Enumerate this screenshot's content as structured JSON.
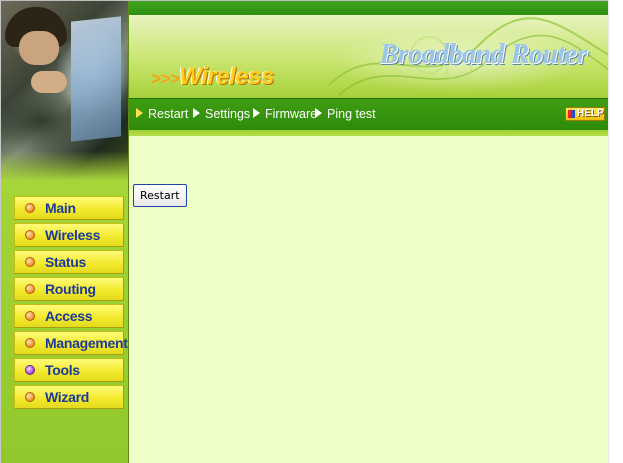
{
  "banner": {
    "section_prefix": ">>>",
    "section_title": "Wireless",
    "brand": "Broadband Router"
  },
  "topbar": {
    "items": [
      {
        "label": "Restart"
      },
      {
        "label": "Settings"
      },
      {
        "label": "Firmware"
      },
      {
        "label": "Ping test"
      }
    ],
    "help_label": "HELP"
  },
  "sidebar": {
    "items": [
      {
        "label": "Main",
        "active": false
      },
      {
        "label": "Wireless",
        "active": false
      },
      {
        "label": "Status",
        "active": false
      },
      {
        "label": "Routing",
        "active": false
      },
      {
        "label": "Access",
        "active": false
      },
      {
        "label": "Management",
        "active": false
      },
      {
        "label": "Tools",
        "active": true
      },
      {
        "label": "Wizard",
        "active": false
      }
    ]
  },
  "main": {
    "restart_button_label": "Restart"
  },
  "colors": {
    "header_green": "#2e8a0a",
    "content_bg": "#eeffc8",
    "sidebar_green": "#9ed133",
    "nav_yellow": "#f3ea2f",
    "nav_text": "#1b3a9a"
  }
}
